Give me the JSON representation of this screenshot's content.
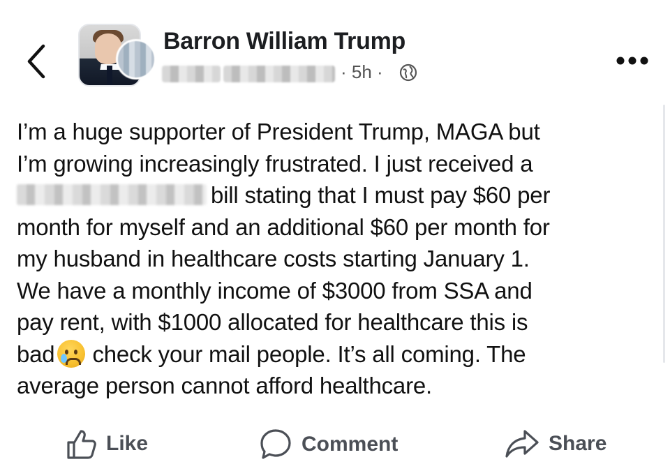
{
  "header": {
    "back_icon": "chevron-left-icon",
    "author_name": "Barron William Trump",
    "time": "· 5h ·",
    "privacy_icon": "globe-icon",
    "more_icon": "more-horizontal-icon"
  },
  "post": {
    "line1": "I’m a huge supporter of President Trump, MAGA but",
    "line2": "I’m growing increasingly frustrated. I just received a",
    "line3": "bill stating that I must pay $60 per",
    "line4": "month for myself and an additional $60 per month for",
    "line5": "my husband in healthcare costs starting January 1.",
    "line6": "We have a monthly income of $3000 from SSA and",
    "line7": "pay rent, with $1000 allocated for healthcare this is",
    "line8a": "bad",
    "line8b": "check your mail people. It’s all coming. The",
    "line9": "average person cannot afford healthcare.",
    "emoji": "crying-face-icon"
  },
  "actions": {
    "like": "Like",
    "comment": "Comment",
    "share": "Share"
  },
  "colors": {
    "text": "#1c1e21",
    "meta": "#555555",
    "action": "#4b4f56"
  }
}
